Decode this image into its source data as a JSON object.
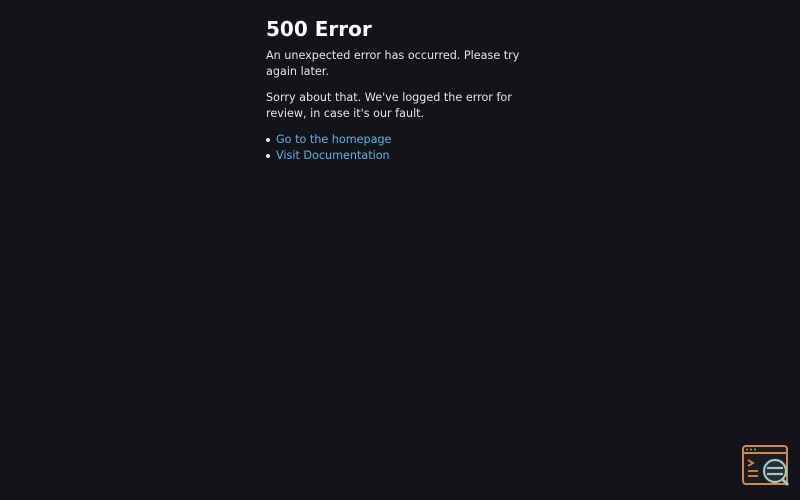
{
  "error": {
    "title": "500 Error",
    "message": "An unexpected error has occurred. Please try again later.",
    "apology": "Sorry about that. We've logged the error for review, in case it's our fault."
  },
  "links": [
    {
      "label": "Go to the homepage"
    },
    {
      "label": "Visit Documentation"
    }
  ],
  "devtools": {
    "icon": "devtools-icon",
    "colors": {
      "frame": "#d08a4c",
      "lens": "#9fc9c4"
    }
  }
}
